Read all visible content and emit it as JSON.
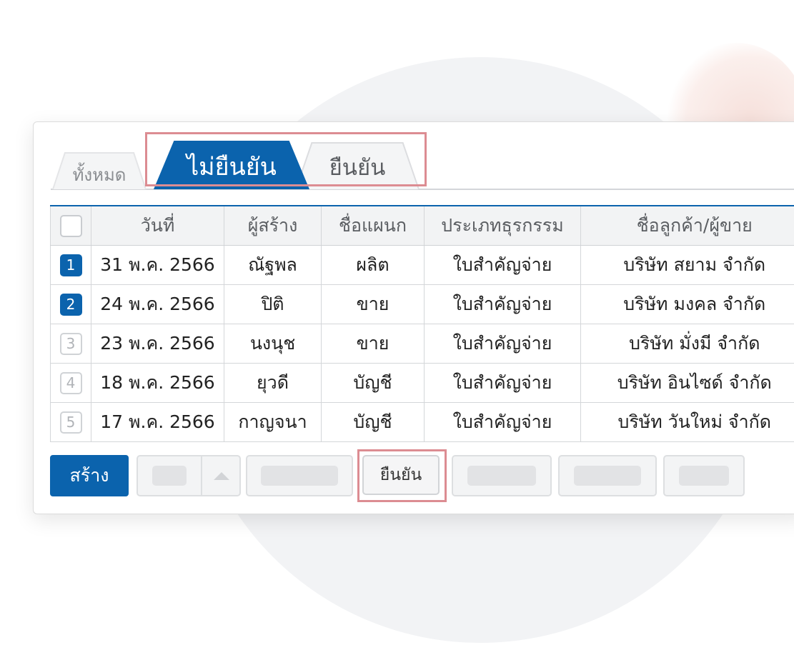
{
  "tabs": {
    "all": "ทั้งหมด",
    "unconfirmed": "ไม่ยืนยัน",
    "confirmed": "ยืนยัน"
  },
  "table": {
    "headers": [
      "วันที่",
      "ผู้สร้าง",
      "ชื่อแผนก",
      "ประเภทธุรกรรม",
      "ชื่อลูกค้า/ผู้ขาย"
    ],
    "rows": [
      {
        "no": "1",
        "checked": true,
        "date": "31 พ.ค. 2566",
        "creator": "ณัฐพล",
        "dept": "ผลิต",
        "type": "ใบสำคัญจ่าย",
        "party": "บริษัท สยาม จำกัด"
      },
      {
        "no": "2",
        "checked": true,
        "date": "24 พ.ค. 2566",
        "creator": "ปิติ",
        "dept": "ขาย",
        "type": "ใบสำคัญจ่าย",
        "party": "บริษัท มงคล จำกัด"
      },
      {
        "no": "3",
        "checked": false,
        "date": "23 พ.ค. 2566",
        "creator": "นงนุช",
        "dept": "ขาย",
        "type": "ใบสำคัญจ่าย",
        "party": "บริษัท มั่งมี จำกัด"
      },
      {
        "no": "4",
        "checked": false,
        "date": "18 พ.ค. 2566",
        "creator": "ยุวดี",
        "dept": "บัญชี",
        "type": "ใบสำคัญจ่าย",
        "party": "บริษัท อินไซด์ จำกัด"
      },
      {
        "no": "5",
        "checked": false,
        "date": "17 พ.ค. 2566",
        "creator": "กาญจนา",
        "dept": "บัญชี",
        "type": "ใบสำคัญจ่าย",
        "party": "บริษัท วันใหม่ จำกัด"
      }
    ]
  },
  "toolbar": {
    "create_label": "สร้าง",
    "confirm_label": "ยืนยัน"
  },
  "colors": {
    "accent": "#0b63ad",
    "highlight": "#dc8c92"
  }
}
